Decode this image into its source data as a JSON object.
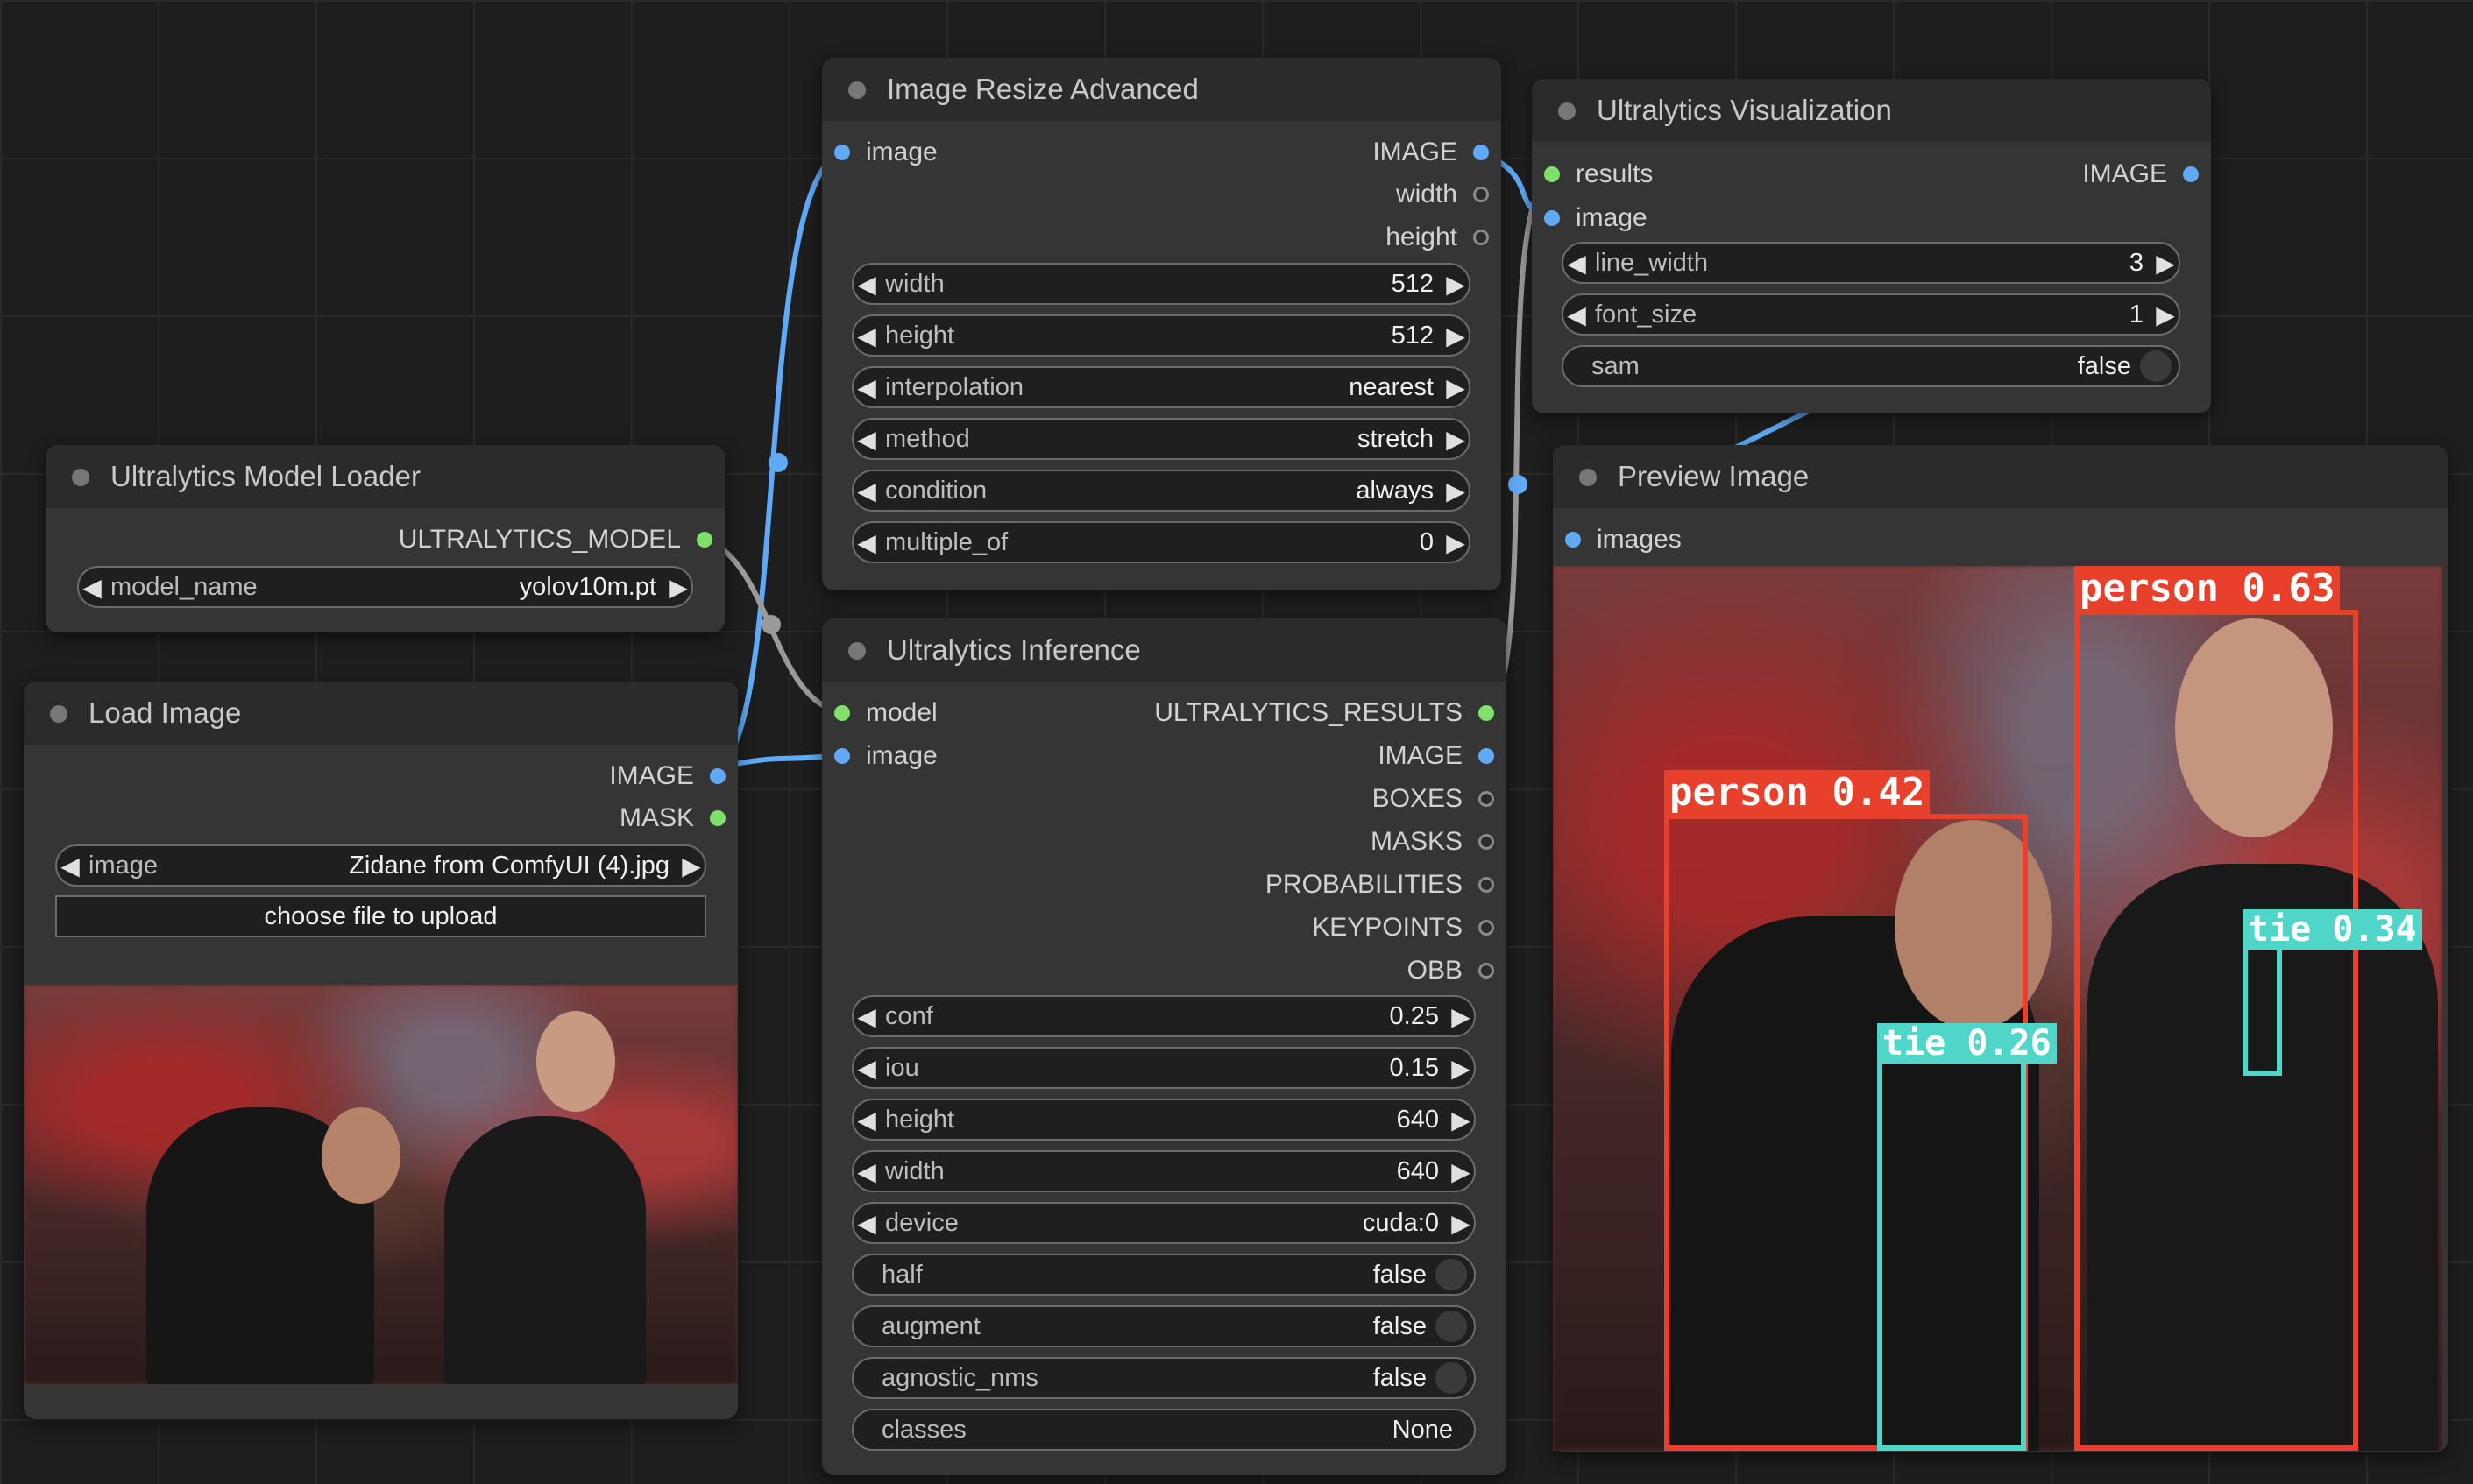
{
  "colors": {
    "image_slot": "#5fa9f5",
    "model_slot": "#7fe06a",
    "person_box": "#e8402a",
    "tie_box": "#4fd6c8"
  },
  "nodes": {
    "model_loader": {
      "title": "Ultralytics Model Loader",
      "outputs": [
        "ULTRALYTICS_MODEL"
      ],
      "widgets": [
        {
          "label": "model_name",
          "value": "yolov10m.pt"
        }
      ]
    },
    "load_image": {
      "title": "Load Image",
      "outputs": [
        "IMAGE",
        "MASK"
      ],
      "widgets": [
        {
          "label": "image",
          "value": "Zidane from ComfyUI (4).jpg"
        }
      ],
      "upload_button": "choose file to upload"
    },
    "resize": {
      "title": "Image Resize Advanced",
      "inputs": [
        "image"
      ],
      "outputs": [
        "IMAGE",
        "width",
        "height"
      ],
      "widgets": [
        {
          "label": "width",
          "value": "512"
        },
        {
          "label": "height",
          "value": "512"
        },
        {
          "label": "interpolation",
          "value": "nearest"
        },
        {
          "label": "method",
          "value": "stretch"
        },
        {
          "label": "condition",
          "value": "always"
        },
        {
          "label": "multiple_of",
          "value": "0"
        }
      ]
    },
    "inference": {
      "title": "Ultralytics Inference",
      "inputs": [
        "model",
        "image"
      ],
      "outputs": [
        "ULTRALYTICS_RESULTS",
        "IMAGE",
        "BOXES",
        "MASKS",
        "PROBABILITIES",
        "KEYPOINTS",
        "OBB"
      ],
      "widgets": [
        {
          "label": "conf",
          "value": "0.25"
        },
        {
          "label": "iou",
          "value": "0.15"
        },
        {
          "label": "height",
          "value": "640"
        },
        {
          "label": "width",
          "value": "640"
        },
        {
          "label": "device",
          "value": "cuda:0"
        }
      ],
      "toggles": [
        {
          "label": "half",
          "value": "false"
        },
        {
          "label": "augment",
          "value": "false"
        },
        {
          "label": "agnostic_nms",
          "value": "false"
        }
      ],
      "text_widget": {
        "label": "classes",
        "value": "None"
      }
    },
    "visualization": {
      "title": "Ultralytics Visualization",
      "inputs": [
        "results",
        "image"
      ],
      "outputs": [
        "IMAGE"
      ],
      "widgets": [
        {
          "label": "line_width",
          "value": "3"
        },
        {
          "label": "font_size",
          "value": "1"
        }
      ],
      "toggles": [
        {
          "label": "sam",
          "value": "false"
        }
      ]
    },
    "preview": {
      "title": "Preview Image",
      "inputs": [
        "images"
      ],
      "detections": [
        {
          "label": "person 0.63"
        },
        {
          "label": "person 0.42"
        },
        {
          "label": "tie 0.34"
        },
        {
          "label": "tie 0.26"
        }
      ]
    }
  }
}
